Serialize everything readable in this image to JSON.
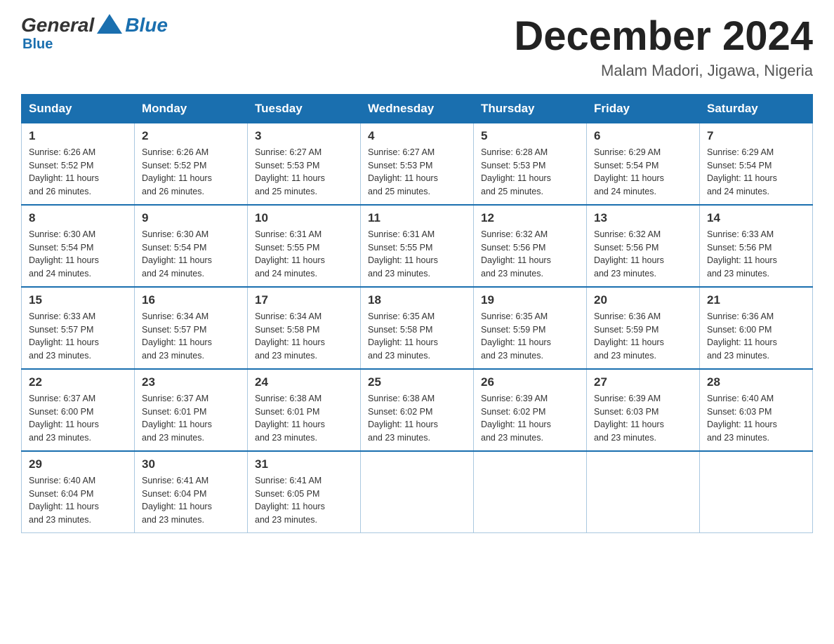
{
  "header": {
    "logo": {
      "general": "General",
      "blue": "Blue"
    },
    "month_title": "December 2024",
    "location": "Malam Madori, Jigawa, Nigeria"
  },
  "days_of_week": [
    "Sunday",
    "Monday",
    "Tuesday",
    "Wednesday",
    "Thursday",
    "Friday",
    "Saturday"
  ],
  "weeks": [
    [
      {
        "day": "1",
        "sunrise": "6:26 AM",
        "sunset": "5:52 PM",
        "daylight": "11 hours and 26 minutes."
      },
      {
        "day": "2",
        "sunrise": "6:26 AM",
        "sunset": "5:52 PM",
        "daylight": "11 hours and 26 minutes."
      },
      {
        "day": "3",
        "sunrise": "6:27 AM",
        "sunset": "5:53 PM",
        "daylight": "11 hours and 25 minutes."
      },
      {
        "day": "4",
        "sunrise": "6:27 AM",
        "sunset": "5:53 PM",
        "daylight": "11 hours and 25 minutes."
      },
      {
        "day": "5",
        "sunrise": "6:28 AM",
        "sunset": "5:53 PM",
        "daylight": "11 hours and 25 minutes."
      },
      {
        "day": "6",
        "sunrise": "6:29 AM",
        "sunset": "5:54 PM",
        "daylight": "11 hours and 24 minutes."
      },
      {
        "day": "7",
        "sunrise": "6:29 AM",
        "sunset": "5:54 PM",
        "daylight": "11 hours and 24 minutes."
      }
    ],
    [
      {
        "day": "8",
        "sunrise": "6:30 AM",
        "sunset": "5:54 PM",
        "daylight": "11 hours and 24 minutes."
      },
      {
        "day": "9",
        "sunrise": "6:30 AM",
        "sunset": "5:54 PM",
        "daylight": "11 hours and 24 minutes."
      },
      {
        "day": "10",
        "sunrise": "6:31 AM",
        "sunset": "5:55 PM",
        "daylight": "11 hours and 24 minutes."
      },
      {
        "day": "11",
        "sunrise": "6:31 AM",
        "sunset": "5:55 PM",
        "daylight": "11 hours and 23 minutes."
      },
      {
        "day": "12",
        "sunrise": "6:32 AM",
        "sunset": "5:56 PM",
        "daylight": "11 hours and 23 minutes."
      },
      {
        "day": "13",
        "sunrise": "6:32 AM",
        "sunset": "5:56 PM",
        "daylight": "11 hours and 23 minutes."
      },
      {
        "day": "14",
        "sunrise": "6:33 AM",
        "sunset": "5:56 PM",
        "daylight": "11 hours and 23 minutes."
      }
    ],
    [
      {
        "day": "15",
        "sunrise": "6:33 AM",
        "sunset": "5:57 PM",
        "daylight": "11 hours and 23 minutes."
      },
      {
        "day": "16",
        "sunrise": "6:34 AM",
        "sunset": "5:57 PM",
        "daylight": "11 hours and 23 minutes."
      },
      {
        "day": "17",
        "sunrise": "6:34 AM",
        "sunset": "5:58 PM",
        "daylight": "11 hours and 23 minutes."
      },
      {
        "day": "18",
        "sunrise": "6:35 AM",
        "sunset": "5:58 PM",
        "daylight": "11 hours and 23 minutes."
      },
      {
        "day": "19",
        "sunrise": "6:35 AM",
        "sunset": "5:59 PM",
        "daylight": "11 hours and 23 minutes."
      },
      {
        "day": "20",
        "sunrise": "6:36 AM",
        "sunset": "5:59 PM",
        "daylight": "11 hours and 23 minutes."
      },
      {
        "day": "21",
        "sunrise": "6:36 AM",
        "sunset": "6:00 PM",
        "daylight": "11 hours and 23 minutes."
      }
    ],
    [
      {
        "day": "22",
        "sunrise": "6:37 AM",
        "sunset": "6:00 PM",
        "daylight": "11 hours and 23 minutes."
      },
      {
        "day": "23",
        "sunrise": "6:37 AM",
        "sunset": "6:01 PM",
        "daylight": "11 hours and 23 minutes."
      },
      {
        "day": "24",
        "sunrise": "6:38 AM",
        "sunset": "6:01 PM",
        "daylight": "11 hours and 23 minutes."
      },
      {
        "day": "25",
        "sunrise": "6:38 AM",
        "sunset": "6:02 PM",
        "daylight": "11 hours and 23 minutes."
      },
      {
        "day": "26",
        "sunrise": "6:39 AM",
        "sunset": "6:02 PM",
        "daylight": "11 hours and 23 minutes."
      },
      {
        "day": "27",
        "sunrise": "6:39 AM",
        "sunset": "6:03 PM",
        "daylight": "11 hours and 23 minutes."
      },
      {
        "day": "28",
        "sunrise": "6:40 AM",
        "sunset": "6:03 PM",
        "daylight": "11 hours and 23 minutes."
      }
    ],
    [
      {
        "day": "29",
        "sunrise": "6:40 AM",
        "sunset": "6:04 PM",
        "daylight": "11 hours and 23 minutes."
      },
      {
        "day": "30",
        "sunrise": "6:41 AM",
        "sunset": "6:04 PM",
        "daylight": "11 hours and 23 minutes."
      },
      {
        "day": "31",
        "sunrise": "6:41 AM",
        "sunset": "6:05 PM",
        "daylight": "11 hours and 23 minutes."
      },
      null,
      null,
      null,
      null
    ]
  ],
  "labels": {
    "sunrise": "Sunrise:",
    "sunset": "Sunset:",
    "daylight": "Daylight:"
  }
}
